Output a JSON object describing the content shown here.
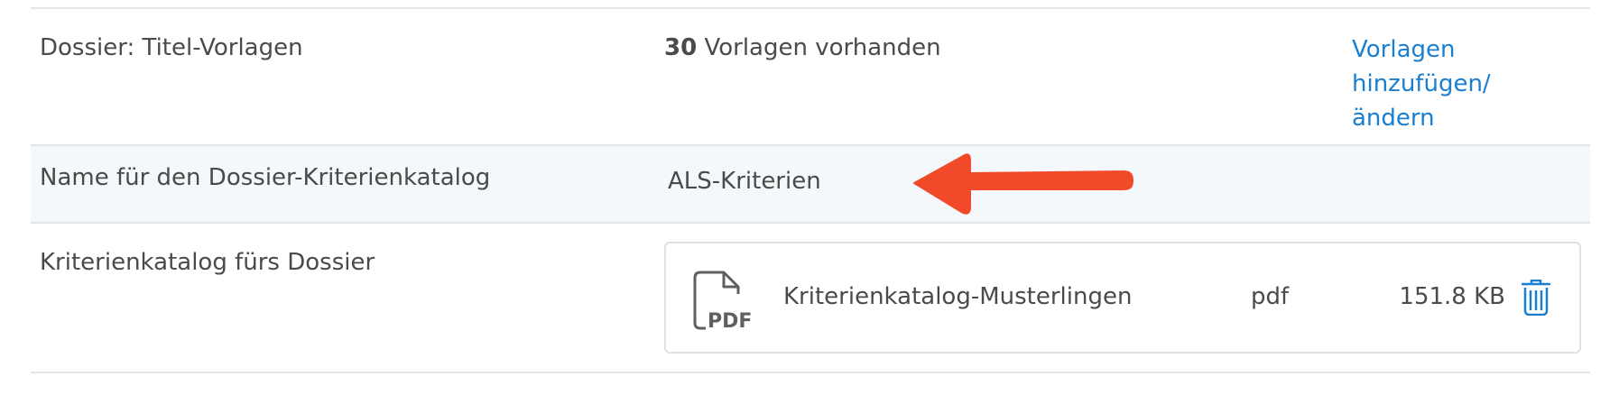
{
  "rows": [
    {
      "label": "Dossier: Titel-Vorlagen",
      "count": "30",
      "value_text": " Vorlagen vorhanden",
      "action_lines": [
        "Vorlagen",
        "hinzufügen/",
        "ändern"
      ]
    },
    {
      "label": "Name für den Dossier-Kriterienkatalog",
      "value": "ALS-Kriterien"
    },
    {
      "label": "Kriterienkatalog fürs Dossier",
      "file": {
        "icon": "pdf-file-icon",
        "icon_text": "PDF",
        "name": "Kriterienkatalog-Musterlingen",
        "type": "pdf",
        "size": "151.8 KB",
        "delete_icon": "trash-icon"
      }
    }
  ],
  "annotation": {
    "icon": "arrow-left-icon",
    "color": "#f04a2a"
  },
  "colors": {
    "link": "#1a7fd0",
    "highlight_row": "#f5f8fa",
    "border": "#e2e4e6"
  }
}
